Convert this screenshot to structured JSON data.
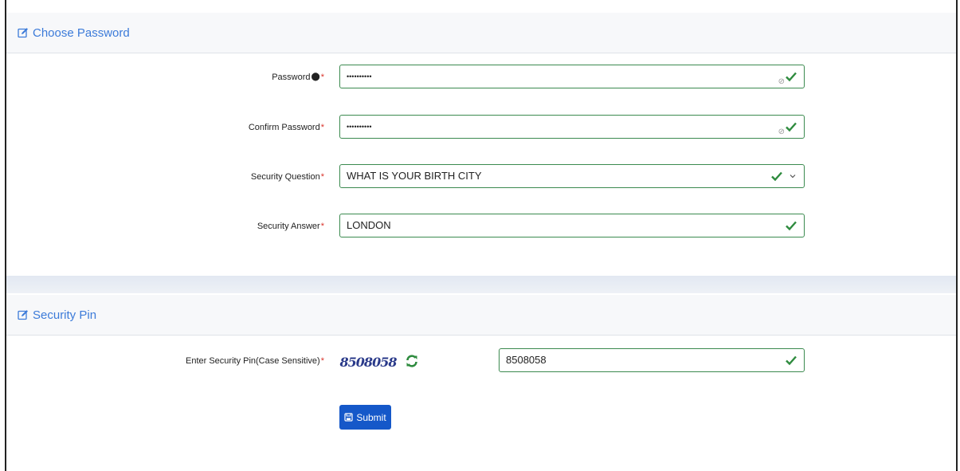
{
  "choose_password": {
    "title": "Choose Password",
    "password": {
      "label": "Password",
      "value": "••••••••••"
    },
    "confirm_password": {
      "label": "Confirm Password",
      "value": "••••••••••"
    },
    "security_question": {
      "label": "Security Question",
      "value": "WHAT IS YOUR BIRTH CITY"
    },
    "security_answer": {
      "label": "Security Answer",
      "value": "LONDON"
    }
  },
  "security_pin": {
    "title": "Security Pin",
    "label": "Enter Security Pin(Case Sensitive)",
    "captcha_text": "8508058",
    "value": "8508058",
    "submit_label": "Submit"
  },
  "required_mark": "*",
  "colors": {
    "accent": "#3c7bd9",
    "valid": "#2e8b3e",
    "required": "#d9342b",
    "submit": "#1558c9"
  },
  "icons": [
    "edit-icon",
    "info-icon",
    "eye-slash-icon",
    "check-icon",
    "chevron-down-icon",
    "refresh-icon",
    "save-icon"
  ]
}
